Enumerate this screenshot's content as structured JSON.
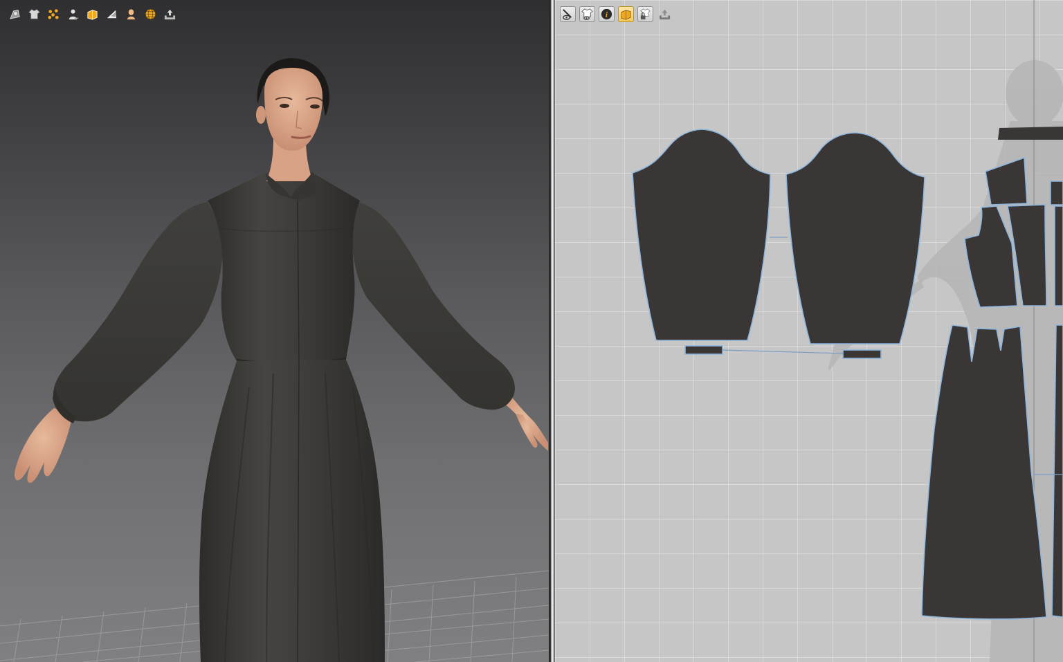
{
  "app": {
    "accent_color": "#f0a81e",
    "garment_color": "#3a3636",
    "outline_color": "#8fb6dd"
  },
  "viewport_3d": {
    "toolbar": [
      {
        "icon": "avatar-display-icon"
      },
      {
        "icon": "garment-display-icon"
      },
      {
        "icon": "pins-display-icon"
      },
      {
        "icon": "avatar-figure-icon"
      },
      {
        "icon": "texture-display-icon",
        "active": true
      },
      {
        "icon": "fabric-mesh-icon"
      },
      {
        "icon": "avatar-skin-icon"
      },
      {
        "icon": "globe-render-icon"
      },
      {
        "icon": "export-tray-icon"
      }
    ],
    "scene": {
      "subject": "avatar-wearing-dress",
      "floor": "grid-floor"
    }
  },
  "viewport_2d": {
    "toolbar": [
      {
        "icon": "visibility-icon"
      },
      {
        "icon": "garment-visibility-icon"
      },
      {
        "icon": "info-icon"
      },
      {
        "icon": "texture-view-icon",
        "active": true
      },
      {
        "icon": "lock-garment-icon"
      },
      {
        "icon": "export-tray-icon"
      }
    ],
    "pattern_pieces": [
      {
        "name": "sleeve-left"
      },
      {
        "name": "sleeve-right"
      },
      {
        "name": "cuff-left"
      },
      {
        "name": "cuff-right"
      },
      {
        "name": "collar-band"
      },
      {
        "name": "bodice-yoke"
      },
      {
        "name": "bodice-front-left"
      },
      {
        "name": "bodice-front-right"
      },
      {
        "name": "skirt-front"
      },
      {
        "name": "skirt-side"
      }
    ]
  }
}
